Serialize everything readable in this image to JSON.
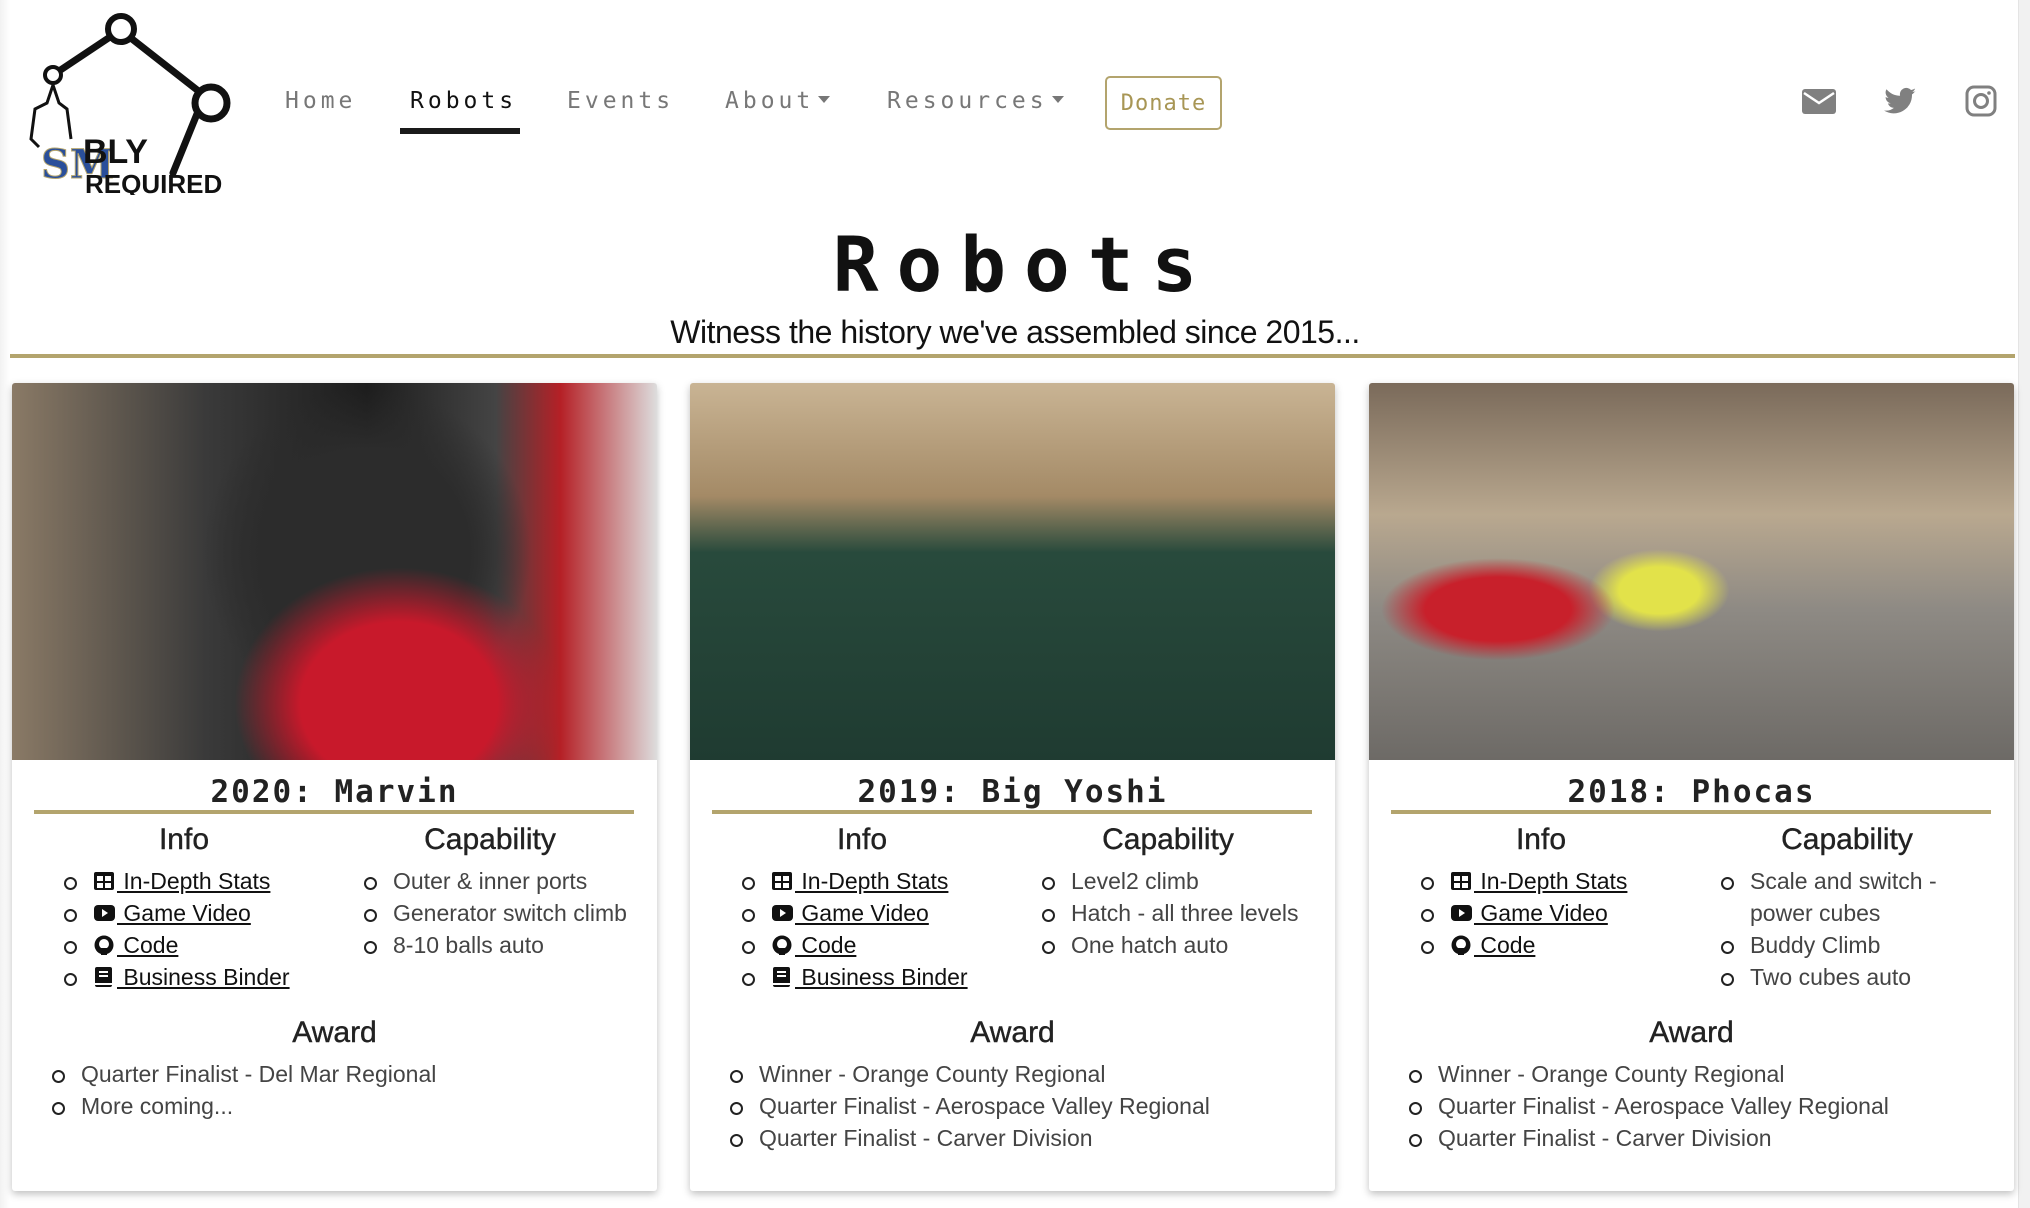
{
  "logo": {
    "text_top": "BLY",
    "text_bottom": "REQUIRED",
    "monogram": "SM"
  },
  "nav": {
    "items": [
      {
        "label": "Home",
        "active": false
      },
      {
        "label": "Robots",
        "active": true
      },
      {
        "label": "Events",
        "active": false
      },
      {
        "label": "About",
        "active": false,
        "dropdown": true
      },
      {
        "label": "Resources",
        "active": false,
        "dropdown": true
      }
    ],
    "donate_label": "Donate",
    "social_icons": [
      "envelope-icon",
      "twitter-icon",
      "instagram-icon"
    ]
  },
  "page": {
    "title": "Robots",
    "subtitle": "Witness the history we've assembled since 2015..."
  },
  "colors": {
    "accent_gold": "#b3a46d",
    "nav_text": "#777777",
    "icon_gray": "#808080"
  },
  "labels": {
    "info": "Info",
    "capability": "Capability",
    "award": "Award"
  },
  "robots": [
    {
      "title": "2020: Marvin",
      "info": [
        {
          "icon": "table-icon",
          "label": " In-Depth Stats"
        },
        {
          "icon": "youtube-icon",
          "label": " Game Video"
        },
        {
          "icon": "github-icon",
          "label": " Code"
        },
        {
          "icon": "book-icon",
          "label": " Business Binder"
        }
      ],
      "capability": [
        "Outer & inner ports",
        "Generator switch climb",
        "8-10 balls auto"
      ],
      "award": [
        "Quarter Finalist - Del Mar Regional",
        "More coming..."
      ]
    },
    {
      "title": "2019: Big Yoshi",
      "info": [
        {
          "icon": "table-icon",
          "label": " In-Depth Stats"
        },
        {
          "icon": "youtube-icon",
          "label": " Game Video"
        },
        {
          "icon": "github-icon",
          "label": " Code"
        },
        {
          "icon": "book-icon",
          "label": " Business Binder"
        }
      ],
      "capability": [
        "Level2 climb",
        "Hatch - all three levels",
        "One hatch auto"
      ],
      "award": [
        "Winner - Orange County Regional",
        "Quarter Finalist - Aerospace Valley Regional",
        "Quarter Finalist - Carver Division"
      ]
    },
    {
      "title": "2018: Phocas",
      "info": [
        {
          "icon": "table-icon",
          "label": " In-Depth Stats"
        },
        {
          "icon": "youtube-icon",
          "label": " Game Video"
        },
        {
          "icon": "github-icon",
          "label": " Code"
        }
      ],
      "capability": [
        "Scale and switch - power cubes",
        "Buddy Climb",
        "Two cubes auto"
      ],
      "award": [
        "Winner - Orange County Regional",
        "Quarter Finalist - Aerospace Valley Regional",
        "Quarter Finalist - Carver Division"
      ]
    }
  ]
}
